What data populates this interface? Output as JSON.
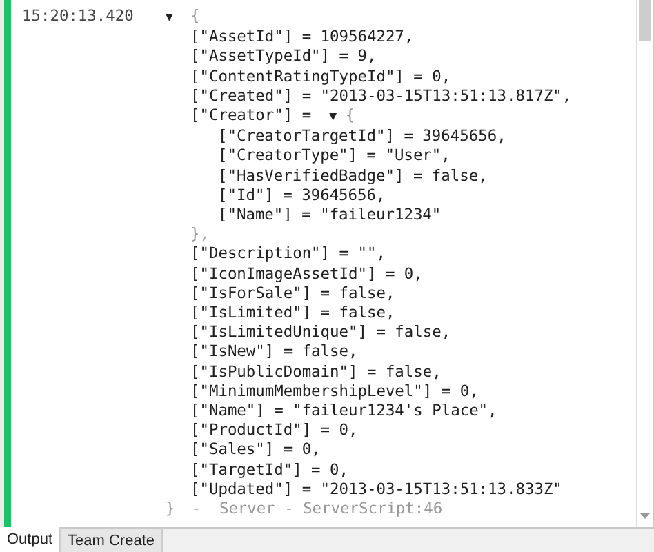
{
  "output": {
    "entry": {
      "timestamp": "15:20:13.420",
      "toggle": "▼",
      "expanded": true,
      "open": "{",
      "fields": [
        {
          "kind": "value",
          "text": "[\"AssetId\"] = 109564227,"
        },
        {
          "kind": "value",
          "text": "[\"AssetTypeId\"] = 9,"
        },
        {
          "kind": "value",
          "text": "[\"ContentRatingTypeId\"] = 0,"
        },
        {
          "kind": "value",
          "text": "[\"Created\"] = \"2013-03-15T13:51:13.817Z\","
        },
        {
          "kind": "table",
          "key": "[\"Creator\"] =",
          "toggle": "▼",
          "expanded": true,
          "open": "{",
          "close": "},",
          "fields": [
            {
              "kind": "value",
              "text": "[\"CreatorTargetId\"] = 39645656,"
            },
            {
              "kind": "value",
              "text": "[\"CreatorType\"] = \"User\","
            },
            {
              "kind": "value",
              "text": "[\"HasVerifiedBadge\"] = false,"
            },
            {
              "kind": "value",
              "text": "[\"Id\"] = 39645656,"
            },
            {
              "kind": "value",
              "text": "[\"Name\"] = \"faileur1234\""
            }
          ]
        },
        {
          "kind": "value",
          "text": "[\"Description\"] = \"\","
        },
        {
          "kind": "value",
          "text": "[\"IconImageAssetId\"] = 0,"
        },
        {
          "kind": "value",
          "text": "[\"IsForSale\"] = false,"
        },
        {
          "kind": "value",
          "text": "[\"IsLimited\"] = false,"
        },
        {
          "kind": "value",
          "text": "[\"IsLimitedUnique\"] = false,"
        },
        {
          "kind": "value",
          "text": "[\"IsNew\"] = false,"
        },
        {
          "kind": "value",
          "text": "[\"IsPublicDomain\"] = false,"
        },
        {
          "kind": "value",
          "text": "[\"MinimumMembershipLevel\"] = 0,"
        },
        {
          "kind": "value",
          "text": "[\"Name\"] = \"faileur1234's Place\","
        },
        {
          "kind": "value",
          "text": "[\"ProductId\"] = 0,"
        },
        {
          "kind": "value",
          "text": "[\"Sales\"] = 0,"
        },
        {
          "kind": "value",
          "text": "[\"TargetId\"] = 0,"
        },
        {
          "kind": "value",
          "text": "[\"Updated\"] = \"2013-03-15T13:51:13.833Z\""
        }
      ],
      "close": "}",
      "source": "-  Server - ServerScript:46"
    }
  },
  "tabs": [
    {
      "label": "Output",
      "selected": true
    },
    {
      "label": "Team Create",
      "selected": false
    }
  ]
}
